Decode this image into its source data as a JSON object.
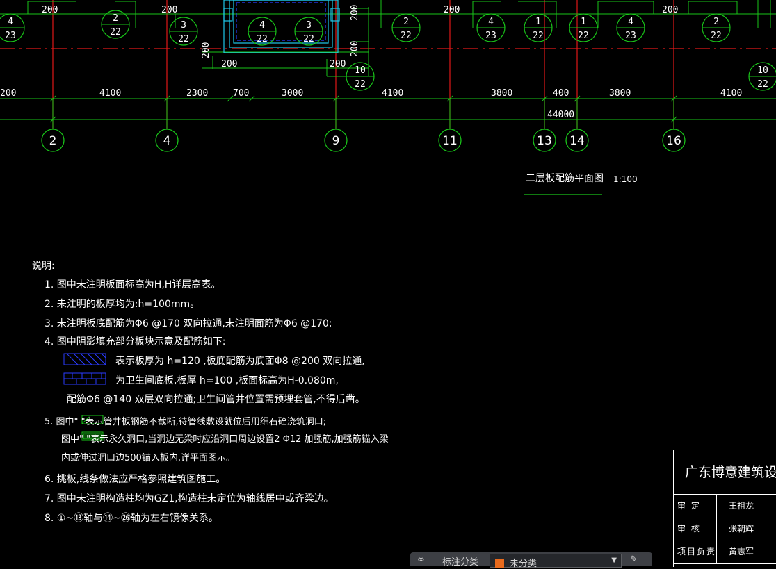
{
  "drawing": {
    "top_dims": [
      "200",
      "200",
      "200",
      "200",
      "200",
      "200",
      "200",
      "200",
      "200"
    ],
    "tags": [
      {
        "n": "4",
        "d": "23"
      },
      {
        "n": "2",
        "d": "22"
      },
      {
        "n": "3",
        "d": "22"
      },
      {
        "n": "4",
        "d": "22"
      },
      {
        "n": "3",
        "d": "22"
      },
      {
        "n": "10",
        "d": "22"
      },
      {
        "n": "2",
        "d": "22"
      },
      {
        "n": "4",
        "d": "23"
      },
      {
        "n": "1",
        "d": "22"
      },
      {
        "n": "1",
        "d": "22"
      },
      {
        "n": "4",
        "d": "23"
      },
      {
        "n": "2",
        "d": "22"
      },
      {
        "n": "10",
        "d": "22"
      }
    ],
    "spans": [
      "200",
      "4100",
      "2300",
      "700",
      "3000",
      "4100",
      "3800",
      "400",
      "3800",
      "4100"
    ],
    "total": "44000",
    "axes": [
      "2",
      "4",
      "9",
      "11",
      "13",
      "14",
      "16"
    ],
    "plan_title": "二层板配筋平面图",
    "plan_scale": "1:100"
  },
  "notes": {
    "title": "说明:",
    "lines": [
      "1. 图中未注明板面标高为H,H详层高表。",
      "2. 未注明的板厚均为:h=100mm。",
      "3. 未注明板底配筋为Φ6 @170 双向拉通,未注明面筋为Φ6 @170;",
      "4. 图中阴影填充部分板块示意及配筋如下:",
      "表示板厚为  h=120 ,板底配筋为底面Φ8 @200 双向拉通,",
      "为卫生间底板,板厚  h=100 ,板面标高为H-0.080m,",
      "配筋Φ6 @140 双层双向拉通;卫生间管井位置需预埋套管,不得后凿。",
      "5. 图中\"        \"表示管井板钢筋不截断,待管线敷设就位后用细石砼浇筑洞口;",
      "图中\"        \"表示永久洞口,当洞边无梁时应沿洞口周边设置2 Φ12 加强筋,加强筋锚入梁",
      "内或伸过洞口边500锚入板内,详平面图示。",
      "6. 挑板,线条做法应严格参照建筑图施工。",
      "7. 图中未注明构造柱均为GZ1,构造柱未定位为轴线居中或齐梁边。",
      "8. ①~⑬轴与⑭~㉖轴为左右镜像关系。"
    ]
  },
  "titleblock": {
    "company": "广东博意建筑设计院",
    "rows": [
      {
        "k": "审  定",
        "v": "王祖龙"
      },
      {
        "k": "审  核",
        "v": "张朝辉"
      },
      {
        "k": "项目负责",
        "v": "黄志军"
      }
    ]
  },
  "statusbar": {
    "label": "标注分类",
    "selected": "未分类"
  }
}
